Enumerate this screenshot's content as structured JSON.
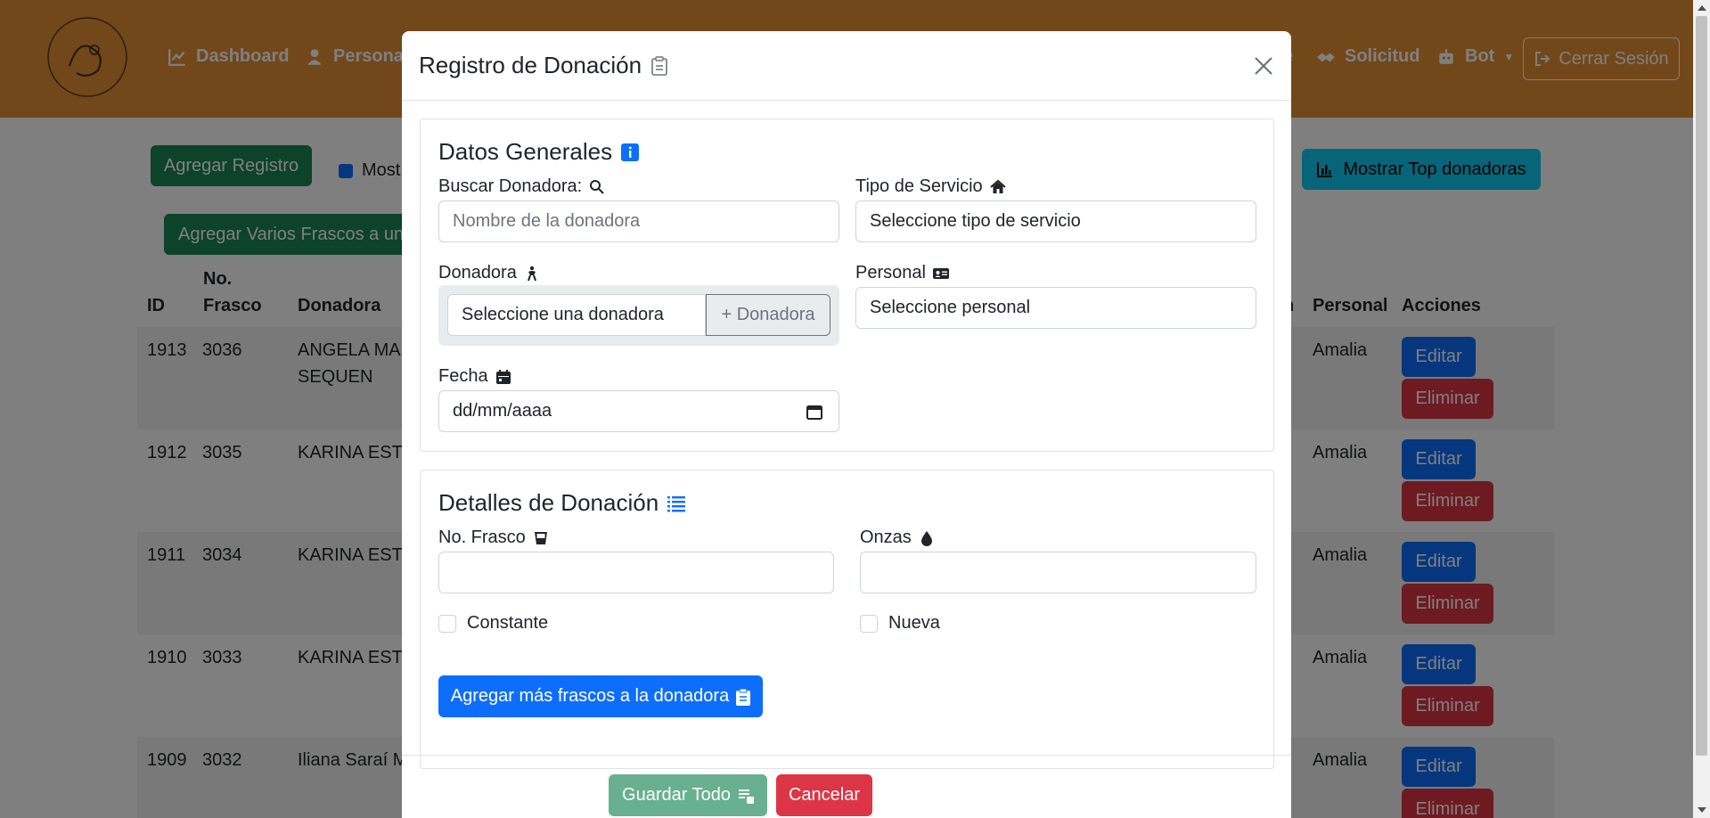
{
  "navbar": {
    "items": [
      {
        "label": "Dashboard",
        "icon": "chart-line-icon"
      },
      {
        "label": "Personal",
        "icon": "user-icon"
      },
      {
        "label": "e",
        "icon": ""
      },
      {
        "label": "Solicitud",
        "icon": "handshake-icon"
      },
      {
        "label": "Bot",
        "icon": "robot-icon"
      }
    ],
    "logout": "Cerrar Sesión"
  },
  "toolbar": {
    "add_record": "Agregar Registro",
    "show_label": "Most",
    "add_multi": "Agregar Varios Frascos a una",
    "top_donors": "Mostrar Top donadoras"
  },
  "table": {
    "headers": {
      "id": "ID",
      "frasco": "No.\nFrasco",
      "donadora": "Donadora",
      "col_n": "n",
      "personal": "Personal",
      "acciones": "Acciones"
    },
    "rows": [
      {
        "id": "1913",
        "frasco": "3036",
        "donadora": "ANGELA MAR\nSEQUEN",
        "personal": "Amalia"
      },
      {
        "id": "1912",
        "frasco": "3035",
        "donadora": "KARINA ESTE",
        "personal": "Amalia"
      },
      {
        "id": "1911",
        "frasco": "3034",
        "donadora": "KARINA ESTE",
        "personal": "Amalia"
      },
      {
        "id": "1910",
        "frasco": "3033",
        "donadora": "KARINA ESTE",
        "personal": "Amalia"
      },
      {
        "id": "1909",
        "frasco": "3032",
        "donadora": "Iliana Saraí M",
        "personal": "Amalia"
      }
    ],
    "edit_label": "Editar",
    "delete_label": "Eliminar"
  },
  "modal": {
    "title": "Registro de Donación",
    "section1": {
      "title": "Datos Generales",
      "search_label": "Buscar Donadora:",
      "search_placeholder": "Nombre de la donadora",
      "service_label": "Tipo de Servicio",
      "service_value": "Seleccione tipo de servicio",
      "donor_label": "Donadora",
      "donor_value": "Seleccione una donadora",
      "add_donor": "+ Donadora",
      "staff_label": "Personal",
      "staff_value": "Seleccione personal",
      "date_label": "Fecha",
      "date_value": "dd/mm/aaaa"
    },
    "section2": {
      "title": "Detalles de Donación",
      "frasco_label": "No. Frasco",
      "onzas_label": "Onzas",
      "constante_label": "Constante",
      "nueva_label": "Nueva",
      "add_more": "Agregar más frascos a la donadora"
    },
    "save_all": "Guardar Todo",
    "cancel": "Cancelar"
  },
  "colors": {
    "navbar": "#e58f34",
    "primary": "#0d6efd",
    "success": "#198754",
    "danger": "#dc3545",
    "info": "#0dcaf0"
  }
}
